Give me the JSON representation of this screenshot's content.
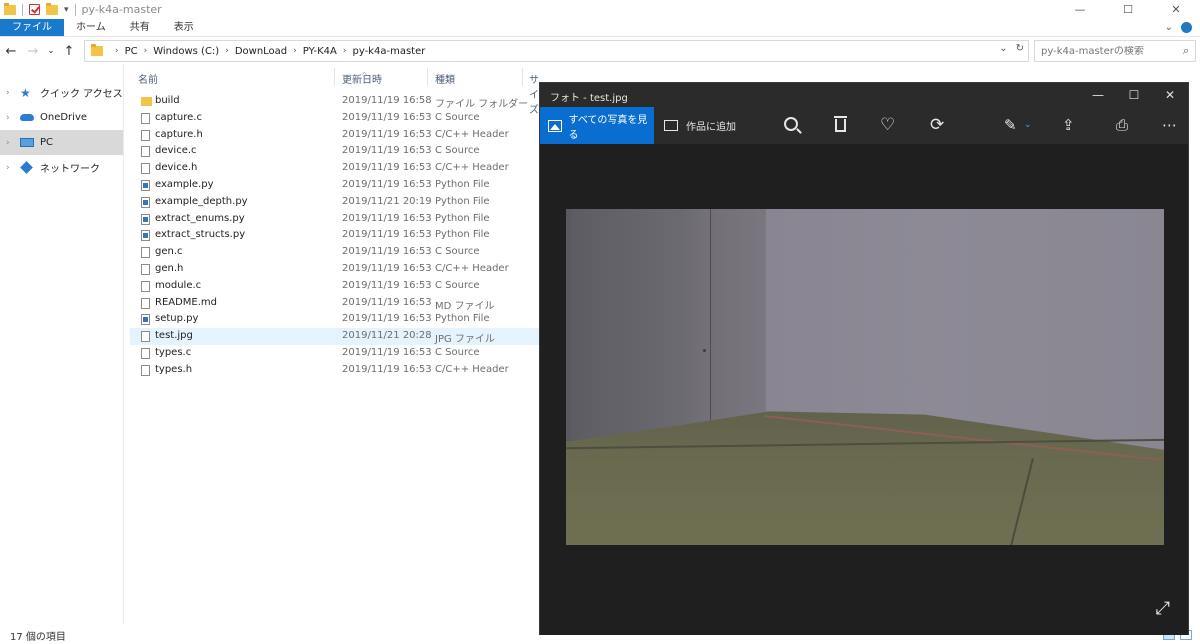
{
  "explorer": {
    "window_title": "py-k4a-master",
    "window_controls": [
      "—",
      "☐",
      "✕"
    ],
    "ribbon_tabs": [
      "ファイル",
      "ホーム",
      "共有",
      "表示"
    ],
    "ribbon_right": [
      "⌄",
      "?"
    ],
    "nav": {
      "back": "←",
      "forward": "→",
      "recent": "⌄",
      "up": "↑"
    },
    "address": {
      "crumbs": [
        "PC",
        "Windows (C:)",
        "DownLoad",
        "PY-K4A",
        "py-k4a-master"
      ],
      "dropdown": "⌄",
      "refresh": "↻"
    },
    "search": {
      "placeholder": "py-k4a-masterの検索",
      "icon": "search-icon"
    },
    "nav_pane": [
      {
        "label": "クイック アクセス",
        "icon": "star-icon"
      },
      {
        "label": "OneDrive",
        "icon": "cloud-icon"
      },
      {
        "label": "PC",
        "icon": "pc-icon",
        "selected": true
      },
      {
        "label": "ネットワーク",
        "icon": "network-icon"
      }
    ],
    "columns": [
      "名前",
      "更新日時",
      "種類",
      "サイズ"
    ],
    "files": [
      {
        "name": "build",
        "date": "2019/11/19 16:58",
        "type": "ファイル フォルダー",
        "kind": "folder"
      },
      {
        "name": "capture.c",
        "date": "2019/11/19 16:53",
        "type": "C Source",
        "kind": "file"
      },
      {
        "name": "capture.h",
        "date": "2019/11/19 16:53",
        "type": "C/C++ Header",
        "kind": "file"
      },
      {
        "name": "device.c",
        "date": "2019/11/19 16:53",
        "type": "C Source",
        "kind": "file"
      },
      {
        "name": "device.h",
        "date": "2019/11/19 16:53",
        "type": "C/C++ Header",
        "kind": "file"
      },
      {
        "name": "example.py",
        "date": "2019/11/19 16:53",
        "type": "Python File",
        "kind": "py"
      },
      {
        "name": "example_depth.py",
        "date": "2019/11/21 20:19",
        "type": "Python File",
        "kind": "py"
      },
      {
        "name": "extract_enums.py",
        "date": "2019/11/19 16:53",
        "type": "Python File",
        "kind": "py"
      },
      {
        "name": "extract_structs.py",
        "date": "2019/11/19 16:53",
        "type": "Python File",
        "kind": "py"
      },
      {
        "name": "gen.c",
        "date": "2019/11/19 16:53",
        "type": "C Source",
        "kind": "file"
      },
      {
        "name": "gen.h",
        "date": "2019/11/19 16:53",
        "type": "C/C++ Header",
        "kind": "file"
      },
      {
        "name": "module.c",
        "date": "2019/11/19 16:53",
        "type": "C Source",
        "kind": "file"
      },
      {
        "name": "README.md",
        "date": "2019/11/19 16:53",
        "type": "MD ファイル",
        "kind": "file"
      },
      {
        "name": "setup.py",
        "date": "2019/11/19 16:53",
        "type": "Python File",
        "kind": "py"
      },
      {
        "name": "test.jpg",
        "date": "2019/11/21 20:28",
        "type": "JPG ファイル",
        "kind": "file",
        "selected": true
      },
      {
        "name": "types.c",
        "date": "2019/11/19 16:53",
        "type": "C Source",
        "kind": "file"
      },
      {
        "name": "types.h",
        "date": "2019/11/19 16:53",
        "type": "C/C++ Header",
        "kind": "file"
      }
    ],
    "status": "17 個の項目"
  },
  "photos": {
    "title": "フォト - test.jpg",
    "controls": [
      "—",
      "☐",
      "✕"
    ],
    "all_photos_label": "すべての写真を見る",
    "add_creation_label": "作品に追加",
    "toolbar_icons": [
      "zoom-icon",
      "delete-icon",
      "heart-icon",
      "rotate-icon",
      "edit-icon",
      "share-icon",
      "print-icon",
      "more-icon"
    ],
    "glyphs": {
      "heart": "♡",
      "rotate": "⟳",
      "edit": "✎",
      "edit_caret": "⌄",
      "share": "⇪",
      "print": "⎙",
      "more": "⋯",
      "expand": "⤢"
    },
    "accent": "#0a6ed1"
  }
}
